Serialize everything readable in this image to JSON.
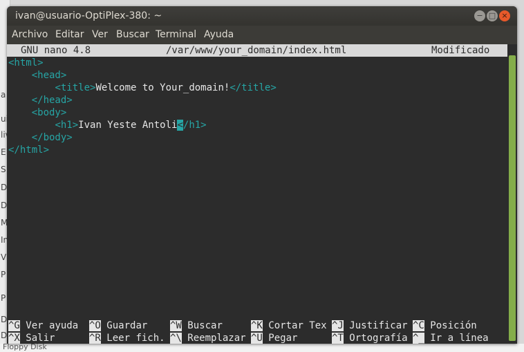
{
  "window": {
    "title": "ivan@usuario-OptiPlex-380: ~",
    "buttons": {
      "minimize": "−",
      "maximize": "□",
      "close": "×"
    }
  },
  "menu": [
    "Archivo",
    "Editar",
    "Ver",
    "Buscar",
    "Terminal",
    "Ayuda"
  ],
  "nano": {
    "version": "GNU nano 4.8",
    "file": "/var/www/your_domain/index.html",
    "status": "Modificado"
  },
  "editor": {
    "html_open": "<html>",
    "head_open": "<head>",
    "title_open": "<title>",
    "title_text": "Welcome to Your_domain!",
    "title_close": "</title>",
    "head_close": "</head>",
    "body_open": "<body>",
    "h1_open": "<h1>",
    "h1_text": "Ivan Yeste Antoli",
    "h1_cursor_char": "<",
    "h1_close_rest": "/h1>",
    "body_close": "</body>",
    "html_close": "</html>"
  },
  "shortcuts": {
    "row1": [
      {
        "key": "^G",
        "label": "Ver ayuda"
      },
      {
        "key": "^O",
        "label": "Guardar"
      },
      {
        "key": "^W",
        "label": "Buscar"
      },
      {
        "key": "^K",
        "label": "Cortar Tex"
      },
      {
        "key": "^J",
        "label": "Justificar"
      },
      {
        "key": "^C",
        "label": "Posición"
      }
    ],
    "row2": [
      {
        "key": "^X",
        "label": "Salir"
      },
      {
        "key": "^R",
        "label": "Leer fich."
      },
      {
        "key": "^\\",
        "label": "Reemplazar"
      },
      {
        "key": "^U",
        "label": "Pegar"
      },
      {
        "key": "^T",
        "label": "Ortografía"
      },
      {
        "key": "^_",
        "label": "Ir a línea"
      }
    ]
  },
  "background": {
    "left_fragments": [
      "a",
      "ui",
      "liv",
      "E",
      "S",
      "D",
      "D",
      "M",
      "In",
      "V",
      "P",
      "P",
      "D",
      "D"
    ],
    "bottom_fragment": "Floppy Disk"
  },
  "colors": {
    "accent": "#26a5a5",
    "scroll_thumb": "#84ad4a",
    "close_button": "#e7592a"
  }
}
